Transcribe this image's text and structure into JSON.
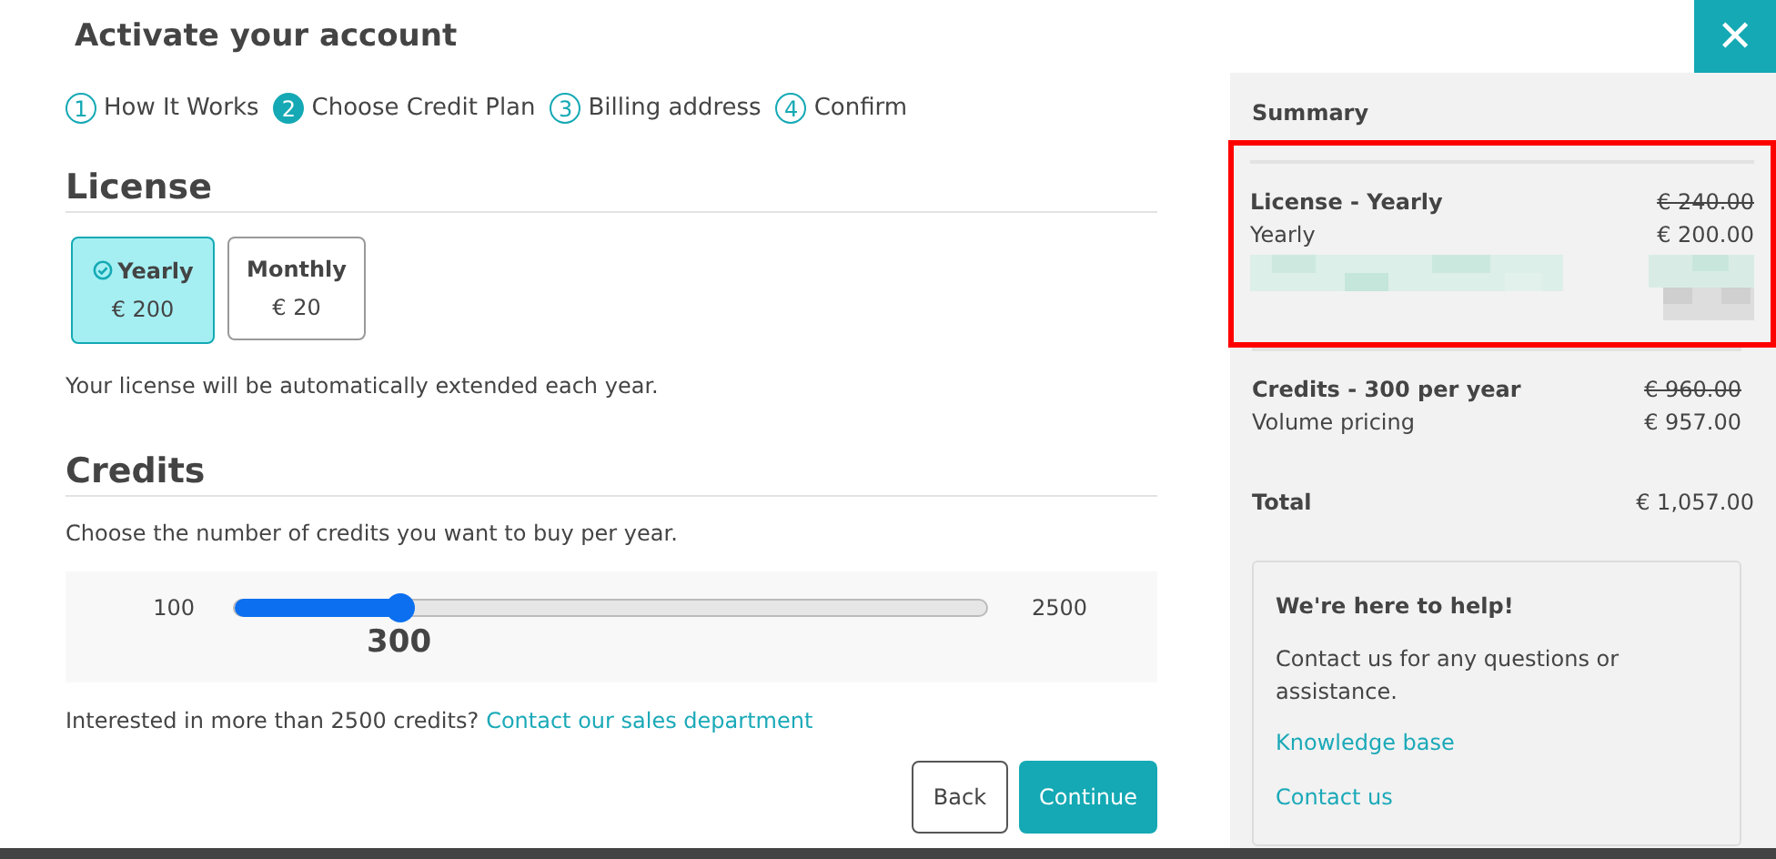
{
  "window": {
    "title": "Activate your account",
    "close_label": "✕"
  },
  "steps": [
    {
      "number": "1",
      "label": "How It Works",
      "selected": false
    },
    {
      "number": "2",
      "label": "Choose Credit Plan",
      "selected": true
    },
    {
      "number": "3",
      "label": "Billing address",
      "selected": false
    },
    {
      "number": "4",
      "label": "Confirm",
      "selected": false
    }
  ],
  "license": {
    "heading": "License",
    "plans": [
      {
        "label": "Yearly",
        "price": "€ 200",
        "selected": true
      },
      {
        "label": "Monthly",
        "price": "€ 20",
        "selected": false
      }
    ],
    "note": "Your license will be automatically extended each year."
  },
  "credits": {
    "heading": "Credits",
    "description": "Choose the number of credits you want to buy per year.",
    "slider": {
      "min_label": "100",
      "max_label": "2500",
      "value": "300",
      "level": 0.22
    },
    "more_text": "Interested in more than 2500 credits?",
    "more_link": "Contact our sales department"
  },
  "buttons": {
    "back": "Back",
    "continue": "Continue"
  },
  "summary": {
    "heading": "Summary",
    "items": [
      {
        "title": "License - Yearly",
        "original_price": "€ 240.00",
        "detail": "Yearly",
        "price": "€ 200.00",
        "highlighted": true,
        "obscured": true
      },
      {
        "title": "Credits - 300 per year",
        "original_price": "€ 960.00",
        "detail": "Volume pricing",
        "price": "€ 957.00",
        "highlighted": false,
        "obscured": false
      }
    ],
    "total_label": "Total",
    "total": "€ 1,057.00"
  },
  "help": {
    "heading": "We're here to help!",
    "text": "Contact us for any questions or assistance.",
    "links": [
      "Knowledge base",
      "Contact us"
    ]
  }
}
